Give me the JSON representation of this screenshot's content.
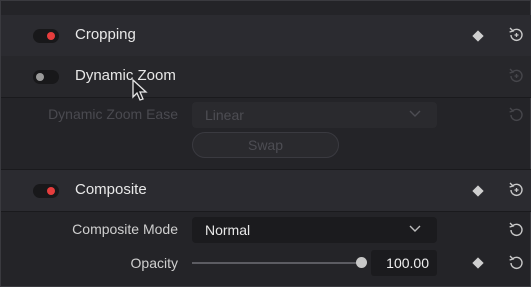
{
  "sections": {
    "cropping": {
      "title": "Cropping",
      "enabled": true
    },
    "dynamic_zoom": {
      "title": "Dynamic Zoom",
      "enabled": false
    },
    "composite": {
      "title": "Composite",
      "enabled": true
    }
  },
  "dynamic_zoom_params": {
    "ease_label": "Dynamic Zoom Ease",
    "ease_value": "Linear",
    "swap_label": "Swap"
  },
  "composite_params": {
    "mode_label": "Composite Mode",
    "mode_value": "Normal",
    "opacity_label": "Opacity",
    "opacity_value": "100.00"
  },
  "icons": {
    "keyframe": "diamond-icon",
    "reset": "reset-icon",
    "dropdown": "chevron-down-icon",
    "cursor": "mouse-pointer-icon"
  },
  "colors": {
    "toggle_on": "#e63d3d",
    "toggle_off": "#9a9a9a"
  }
}
